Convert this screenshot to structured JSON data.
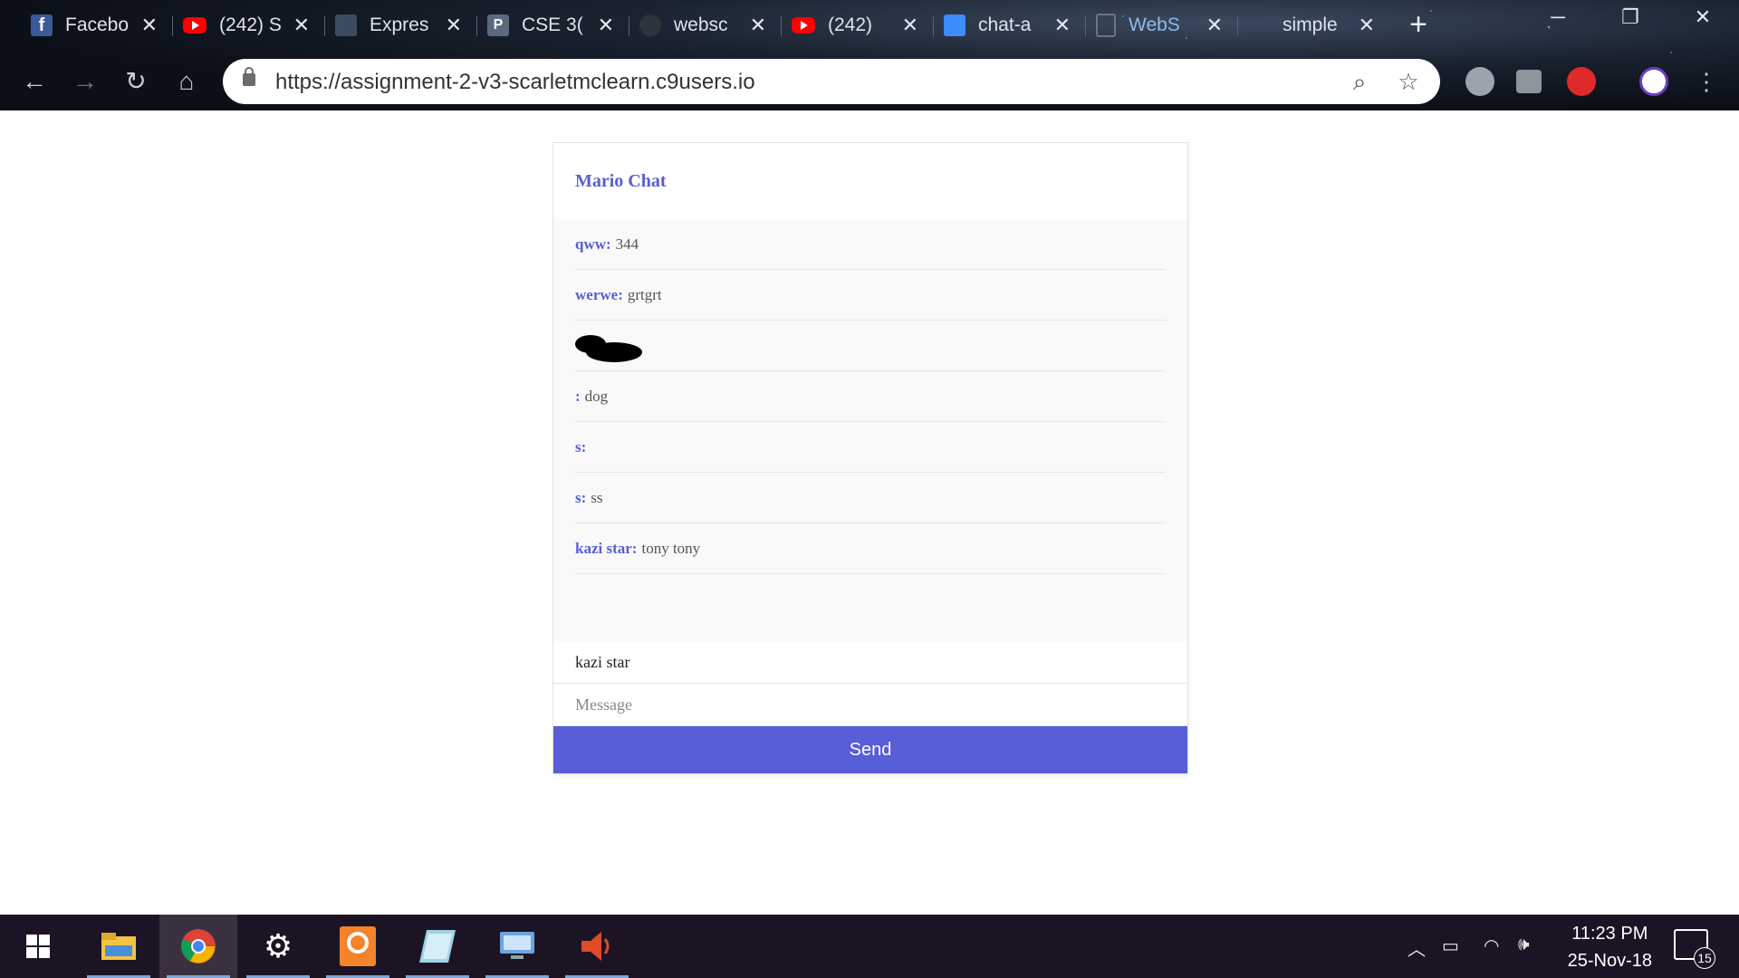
{
  "browser": {
    "tabs": [
      {
        "icon": "facebook-icon",
        "title": "Facebook"
      },
      {
        "icon": "youtube-icon",
        "title": "(242) S"
      },
      {
        "icon": "express-icon",
        "title": "Expres"
      },
      {
        "icon": "p-icon",
        "title": "CSE 3("
      },
      {
        "icon": "github-icon",
        "title": "websc"
      },
      {
        "icon": "youtube-icon",
        "title": "(242)"
      },
      {
        "icon": "chat-icon",
        "title": "chat-a"
      },
      {
        "icon": "document-icon",
        "title": "WebS"
      },
      {
        "icon": "blank-icon",
        "title": "simple"
      }
    ],
    "tab_close_glyph": "✕",
    "new_tab_glyph": "+",
    "url": "https://assignment-2-v3-scarletmclearn.c9users.io",
    "window_controls": {
      "minimize": "─",
      "maximize": "❐",
      "close": "✕"
    }
  },
  "chat": {
    "title": "Mario Chat",
    "messages": [
      {
        "handle": "qww:",
        "text": "344"
      },
      {
        "handle": "werwe:",
        "text": "grtgrt"
      },
      {
        "handle": "",
        "text": "",
        "redacted": true
      },
      {
        "handle": ":",
        "text": "dog"
      },
      {
        "handle": "s:",
        "text": ""
      },
      {
        "handle": "s:",
        "text": "ss"
      },
      {
        "handle": "kazi star:",
        "text": "tony tony"
      }
    ],
    "handle_value": "kazi star",
    "message_placeholder": "Message",
    "send_label": "Send"
  },
  "taskbar": {
    "time": "11:23 PM",
    "date": "25-Nov-18",
    "notification_count": "15"
  },
  "colors": {
    "accent": "#575ed8",
    "taskbar": "#1c1424"
  }
}
